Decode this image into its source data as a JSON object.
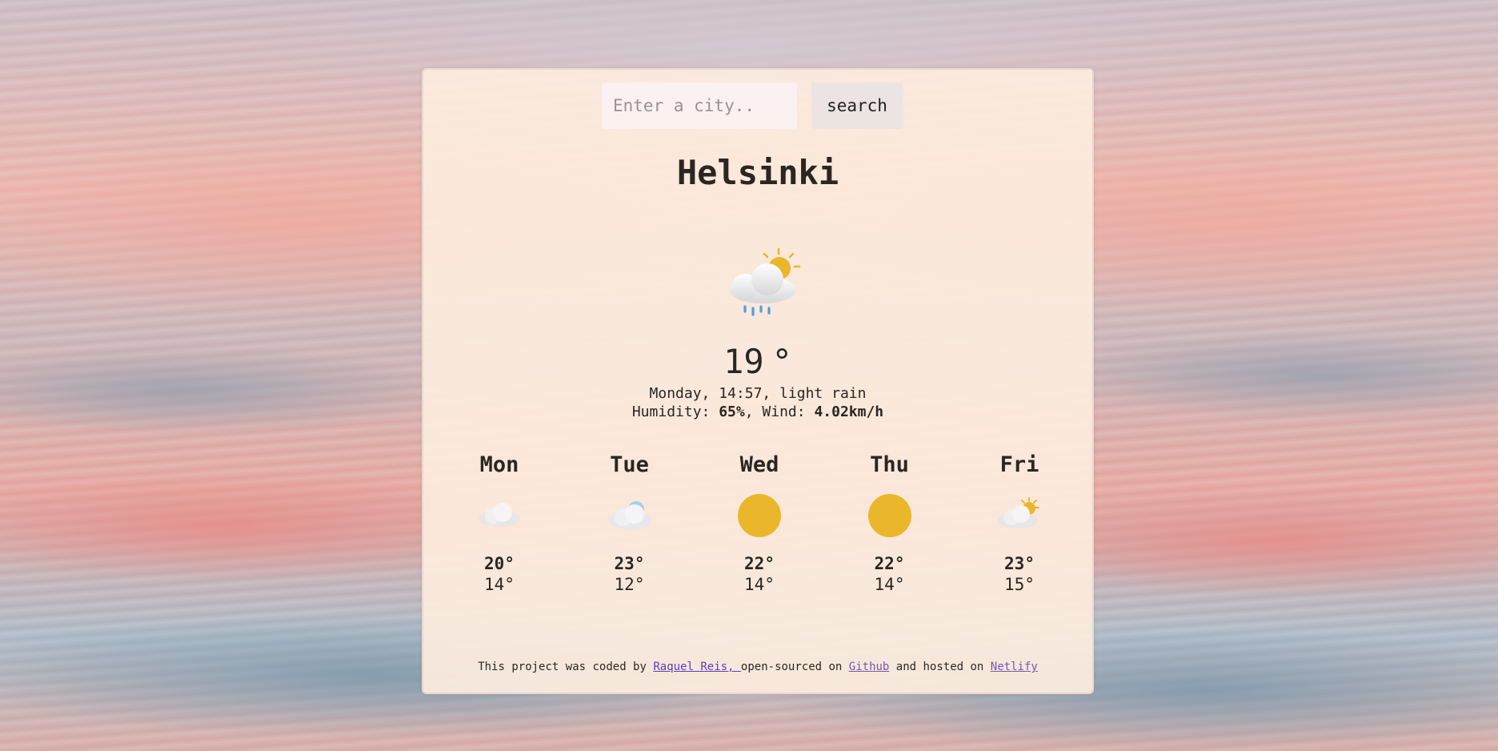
{
  "search": {
    "placeholder": "Enter a city..",
    "button_label": "search"
  },
  "current": {
    "city": "Helsinki",
    "icon": "cloud-rain-sun-icon",
    "temperature": "19",
    "unit": "°",
    "day_time_desc": "Monday, 14:57, light rain",
    "humidity_label": "Humidity: ",
    "humidity": "65%",
    "wind_label": ", Wind: ",
    "wind": "4.02km/h"
  },
  "forecast": [
    {
      "day": "Mon",
      "icon": "cloud-icon",
      "high": "20°",
      "low": "14°"
    },
    {
      "day": "Tue",
      "icon": "cloud-icon",
      "high": "23°",
      "low": "12°"
    },
    {
      "day": "Wed",
      "icon": "sun-icon",
      "high": "22°",
      "low": "14°"
    },
    {
      "day": "Thu",
      "icon": "sun-icon",
      "high": "22°",
      "low": "14°"
    },
    {
      "day": "Fri",
      "icon": "cloud-sun-icon",
      "high": "23°",
      "low": "15°"
    }
  ],
  "footer": {
    "text1": "This project was coded by ",
    "author_link": "Raquel Reis, ",
    "text2": "open-sourced on ",
    "github_link": "Github",
    "text3": " and hosted on ",
    "netlify_link": "Netlify"
  },
  "colors": {
    "card_bg": "#fcecde",
    "sun": "#eab72c",
    "link": "#5a3cc0",
    "rain": "#4aa3d8"
  }
}
